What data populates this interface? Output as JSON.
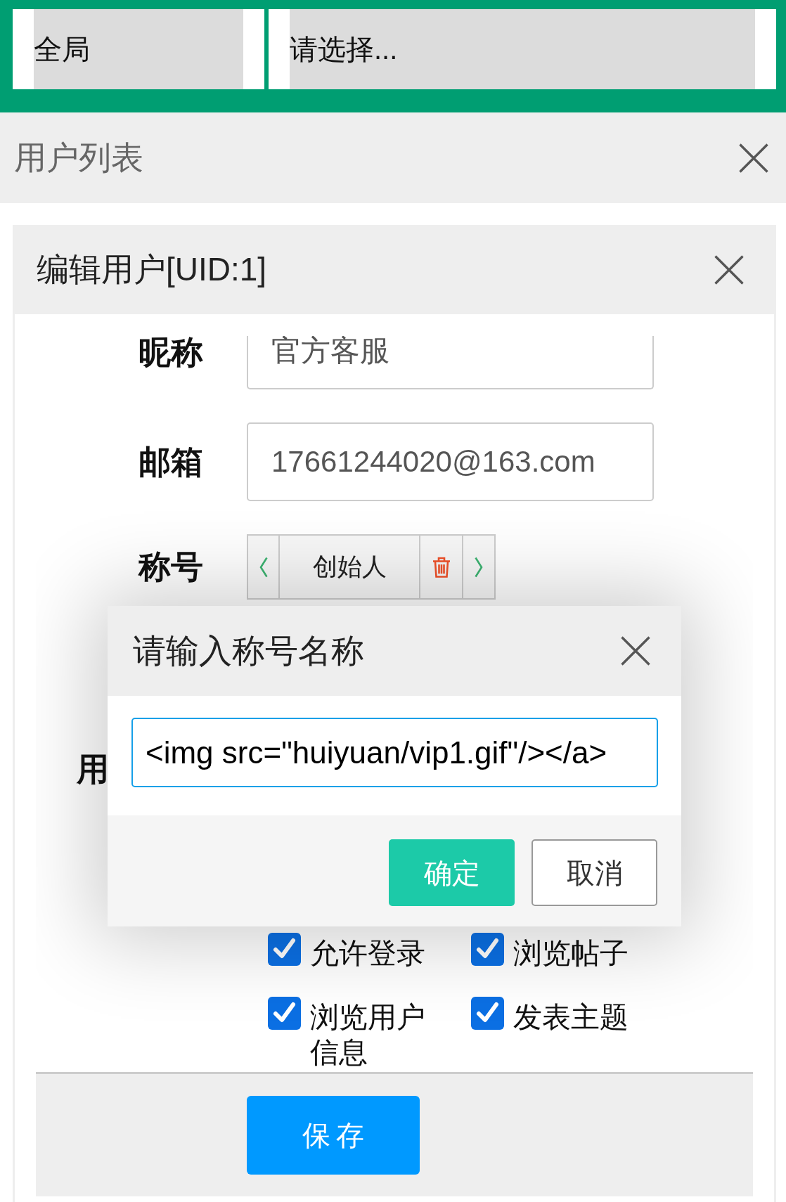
{
  "top_bar": {
    "selects": [
      {
        "value": "全局"
      },
      {
        "value": "请选择..."
      }
    ]
  },
  "list_panel": {
    "title": "用户列表"
  },
  "edit_panel": {
    "title": "编辑用户[UID:1]",
    "fields": [
      {
        "label": "昵称",
        "kind": "input",
        "value": "官方客服"
      },
      {
        "label": "邮箱",
        "kind": "input",
        "value": "17661244020@163.com"
      },
      {
        "label": "称号",
        "kind": "titles",
        "titles": [
          {
            "label": "创始人"
          }
        ]
      },
      {
        "label": "用",
        "kind": "covered"
      }
    ],
    "permissions": [
      {
        "label": "允许登录",
        "checked": true
      },
      {
        "label": "浏览帖子",
        "checked": true
      },
      {
        "label": "浏览用户信息",
        "checked": true
      },
      {
        "label": "发表主题",
        "checked": true
      }
    ],
    "save_button": "保存"
  },
  "title_prompt": {
    "title": "请输入称号名称",
    "value": "<img src=\"huiyuan/vip1.gif\"/></a>",
    "buttons": [
      {
        "label": "确定",
        "kind": "primary"
      },
      {
        "label": "取消",
        "kind": "default"
      }
    ]
  }
}
